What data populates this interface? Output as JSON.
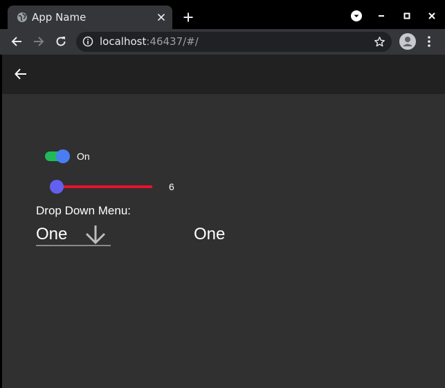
{
  "browser": {
    "tab_title": "App Name",
    "url_host": "localhost",
    "url_rest": ":46437/#/"
  },
  "icons": {
    "favicon": "globe-icon",
    "tab_close": "close-icon",
    "new_tab": "plus-icon",
    "tab_search": "tab-search-icon",
    "minimize": "minimize-icon",
    "maximize": "maximize-icon",
    "close_window": "close-window-icon",
    "back": "arrow-left-icon",
    "forward": "arrow-right-icon",
    "reload": "reload-icon",
    "site_info": "info-icon",
    "bookmark": "star-icon",
    "profile": "avatar-icon",
    "menu": "more-vertical-icon",
    "app_back": "arrow-left-icon",
    "dropdown_arrow": "arrow-down-icon"
  },
  "app": {
    "switch": {
      "label": "On",
      "checked": true
    },
    "slider": {
      "value": "6",
      "fraction": 0.0
    },
    "dropdown": {
      "label": "Drop Down Menu:",
      "value": "One",
      "selected_text": "One"
    }
  },
  "colors": {
    "app_bar": "#212121",
    "app_body": "#303030",
    "switch_track": "#1fb85a",
    "switch_thumb": "#4a7df2",
    "slider_track": "#e8112d",
    "slider_thumb": "#6360f0"
  }
}
